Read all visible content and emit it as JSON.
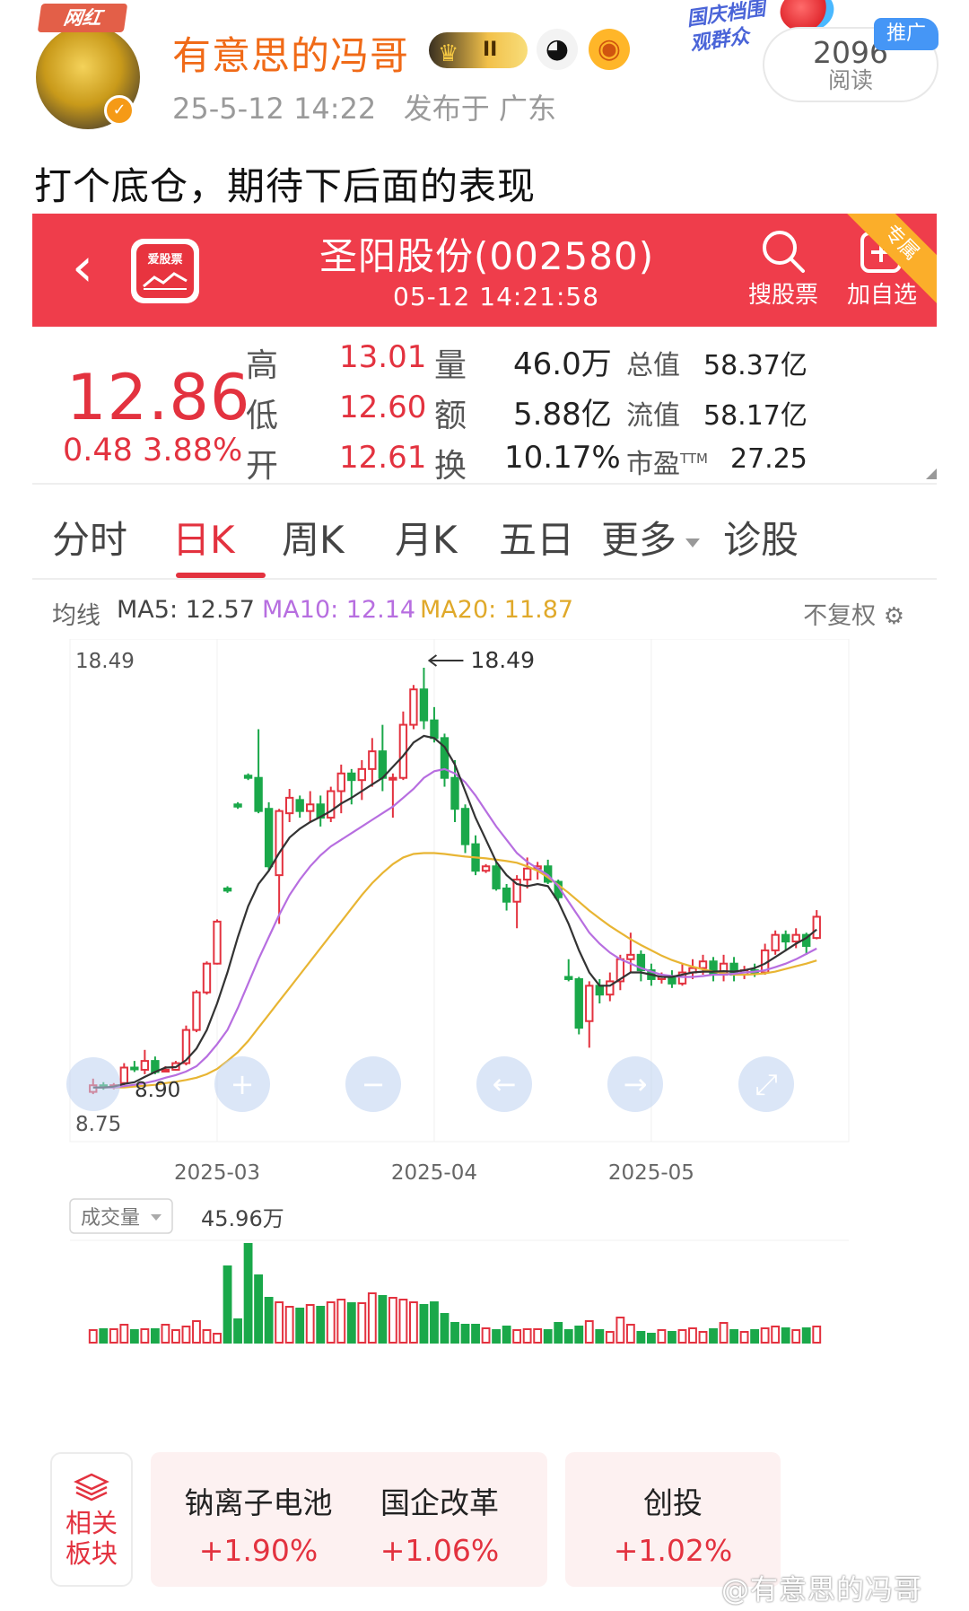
{
  "post": {
    "avatar_badge": "网红",
    "username": "有意思的冯哥",
    "level_badge": "II",
    "posted_time": "25-5-12 14:22",
    "posted_from": "发布于 广东",
    "read_count": "2096",
    "read_label": "阅读",
    "promo_tag": "推广",
    "event_text": "国庆档围观群众",
    "text": "打个底仓，期待下后面的表现"
  },
  "stock": {
    "app_name": "爱股票",
    "title": "圣阳股份(002580)",
    "time": "05-12 14:21:58",
    "search_label": "搜股票",
    "add_label": "加自选",
    "ribbon": "专属",
    "price": "12.86",
    "change": "0.48 3.88%",
    "quote": [
      {
        "label": "高",
        "value": "13.01"
      },
      {
        "label": "低",
        "value": "12.60"
      },
      {
        "label": "开",
        "value": "12.61"
      }
    ],
    "quote2": [
      {
        "label": "量",
        "value": "46.0万"
      },
      {
        "label": "额",
        "value": "5.88亿"
      },
      {
        "label": "换",
        "value": "10.17%"
      }
    ],
    "quote3": [
      {
        "label": "总值",
        "value": "58.37亿"
      },
      {
        "label": "流值",
        "value": "58.17亿"
      },
      {
        "label": "市盈",
        "sup": "TTM",
        "value": "27.25"
      }
    ],
    "tabs": [
      "分时",
      "日K",
      "周K",
      "月K",
      "五日",
      "更多",
      "诊股"
    ],
    "ma": {
      "label": "均线",
      "ma5": "MA5: 12.57",
      "ma10": "MA10: 12.14",
      "ma20": "MA20: 11.87",
      "fq": "不复权"
    },
    "volume_label": "成交量",
    "volume_value": "45.96万",
    "related_label": "相关板块",
    "related": [
      {
        "name": "钠离子电池",
        "pct": "+1.90%"
      },
      {
        "name": "国企改革",
        "pct": "+1.06%"
      },
      {
        "name": "创投",
        "pct": "+1.02%"
      }
    ],
    "watermark": "@有意思的冯哥"
  },
  "colors": {
    "red": "#e3323f",
    "green": "#1aa84a",
    "ma5": "#333333",
    "ma10": "#b76ee0",
    "ma20": "#e8b533",
    "topbar": "#ef3d4b"
  },
  "chart_data": {
    "type": "candlestick",
    "max_label": "18.49",
    "min_label": "8.75",
    "high_annotation": "18.49",
    "low_annotation": "8.90",
    "x_ticks": [
      "2025-03",
      "2025-04",
      "2025-05"
    ],
    "ylim": [
      8.75,
      18.49
    ],
    "candles": [
      [
        8.9,
        9.05,
        8.85,
        9.2
      ],
      [
        9.05,
        9.0,
        8.95,
        9.12
      ],
      [
        9.0,
        9.05,
        8.96,
        9.1
      ],
      [
        9.1,
        9.45,
        9.05,
        9.55
      ],
      [
        9.45,
        9.42,
        9.35,
        9.6
      ],
      [
        9.4,
        9.6,
        9.3,
        9.85
      ],
      [
        9.6,
        9.35,
        9.3,
        9.7
      ],
      [
        9.4,
        9.4,
        9.35,
        9.48
      ],
      [
        9.4,
        9.55,
        9.38,
        9.6
      ],
      [
        9.55,
        10.3,
        9.5,
        10.4
      ],
      [
        10.3,
        11.15,
        10.25,
        11.2
      ],
      [
        11.15,
        11.8,
        11.1,
        11.85
      ],
      [
        11.8,
        12.75,
        11.78,
        12.8
      ],
      [
        13.5,
        13.45,
        13.4,
        13.55
      ],
      [
        15.4,
        15.35,
        15.3,
        15.45
      ],
      [
        16.05,
        16.0,
        15.95,
        16.1
      ],
      [
        16.0,
        15.25,
        15.2,
        17.1
      ],
      [
        15.3,
        14.0,
        13.9,
        15.45
      ],
      [
        13.8,
        15.25,
        12.7,
        15.3
      ],
      [
        15.2,
        15.55,
        15.0,
        15.75
      ],
      [
        15.5,
        15.25,
        15.1,
        15.6
      ],
      [
        15.25,
        15.4,
        15.0,
        15.7
      ],
      [
        15.4,
        15.1,
        14.9,
        15.6
      ],
      [
        15.1,
        15.7,
        15.0,
        15.8
      ],
      [
        15.7,
        16.1,
        15.2,
        16.3
      ],
      [
        16.1,
        15.95,
        15.4,
        16.2
      ],
      [
        15.95,
        16.2,
        15.5,
        16.4
      ],
      [
        16.2,
        16.6,
        15.8,
        16.9
      ],
      [
        16.6,
        16.0,
        15.7,
        17.2
      ],
      [
        16.0,
        16.0,
        15.1,
        16.1
      ],
      [
        16.0,
        17.2,
        15.95,
        17.5
      ],
      [
        17.2,
        18.0,
        17.1,
        18.1
      ],
      [
        18.0,
        17.3,
        17.1,
        18.49
      ],
      [
        17.3,
        16.9,
        16.8,
        17.6
      ],
      [
        16.9,
        16.0,
        15.8,
        17.0
      ],
      [
        16.0,
        15.3,
        15.0,
        16.4
      ],
      [
        15.3,
        14.5,
        14.3,
        15.4
      ],
      [
        14.5,
        13.9,
        13.8,
        14.7
      ],
      [
        13.9,
        14.0,
        13.85,
        14.05
      ],
      [
        14.0,
        13.5,
        13.45,
        14.1
      ],
      [
        13.5,
        13.2,
        13.0,
        13.6
      ],
      [
        13.2,
        13.7,
        12.6,
        13.8
      ],
      [
        13.7,
        13.95,
        13.5,
        14.2
      ],
      [
        13.95,
        14.0,
        13.7,
        14.1
      ],
      [
        14.0,
        13.65,
        13.6,
        14.15
      ],
      [
        13.65,
        13.3,
        13.2,
        13.7
      ],
      [
        11.5,
        11.45,
        11.4,
        11.9
      ],
      [
        11.45,
        10.35,
        10.2,
        11.5
      ],
      [
        10.5,
        11.3,
        9.9,
        11.4
      ],
      [
        11.3,
        11.1,
        10.9,
        11.45
      ],
      [
        11.1,
        11.4,
        10.95,
        11.6
      ],
      [
        11.4,
        11.9,
        11.2,
        12.0
      ],
      [
        11.9,
        12.0,
        11.6,
        12.5
      ],
      [
        12.0,
        11.65,
        11.4,
        12.1
      ],
      [
        11.65,
        11.45,
        11.3,
        11.8
      ],
      [
        11.45,
        11.5,
        11.35,
        11.6
      ],
      [
        11.5,
        11.35,
        11.25,
        11.65
      ],
      [
        11.35,
        11.6,
        11.3,
        11.8
      ],
      [
        11.6,
        11.7,
        11.45,
        11.9
      ],
      [
        11.7,
        11.85,
        11.55,
        12.0
      ],
      [
        11.85,
        11.55,
        11.4,
        11.95
      ],
      [
        11.55,
        11.8,
        11.4,
        12.0
      ],
      [
        11.8,
        11.55,
        11.4,
        11.95
      ],
      [
        11.55,
        11.65,
        11.45,
        11.75
      ],
      [
        11.65,
        11.6,
        11.5,
        11.8
      ],
      [
        11.6,
        12.1,
        11.55,
        12.25
      ],
      [
        12.1,
        12.45,
        12.0,
        12.55
      ],
      [
        12.45,
        12.3,
        12.1,
        12.55
      ],
      [
        12.3,
        12.45,
        12.15,
        12.6
      ],
      [
        12.45,
        12.2,
        12.0,
        12.5
      ],
      [
        12.38,
        12.86,
        12.35,
        13.01
      ]
    ],
    "ma5": [
      9.0,
      9.0,
      9.02,
      9.08,
      9.12,
      9.24,
      9.35,
      9.45,
      9.46,
      9.62,
      9.88,
      10.3,
      10.9,
      11.6,
      12.4,
      13.1,
      13.6,
      13.9,
      14.3,
      14.65,
      14.85,
      15.0,
      15.12,
      15.25,
      15.42,
      15.55,
      15.7,
      15.85,
      16.0,
      16.25,
      16.5,
      16.8,
      16.95,
      16.9,
      16.7,
      16.3,
      15.7,
      15.1,
      14.6,
      14.1,
      13.8,
      13.6,
      13.55,
      13.6,
      13.55,
      13.2,
      12.7,
      12.1,
      11.6,
      11.3,
      11.3,
      11.45,
      11.6,
      11.6,
      11.55,
      11.5,
      11.5,
      11.55,
      11.6,
      11.62,
      11.62,
      11.63,
      11.62,
      11.65,
      11.7,
      11.8,
      11.95,
      12.1,
      12.25,
      12.38,
      12.57
    ],
    "ma10": [
      9.0,
      9.0,
      9.0,
      9.03,
      9.06,
      9.1,
      9.15,
      9.22,
      9.28,
      9.36,
      9.48,
      9.7,
      9.98,
      10.3,
      10.8,
      11.35,
      11.9,
      12.4,
      12.9,
      13.35,
      13.7,
      14.0,
      14.25,
      14.45,
      14.6,
      14.75,
      14.9,
      15.05,
      15.2,
      15.35,
      15.55,
      15.75,
      16.0,
      16.15,
      16.2,
      16.1,
      15.9,
      15.6,
      15.25,
      14.9,
      14.6,
      14.3,
      14.1,
      13.95,
      13.8,
      13.55,
      13.2,
      12.85,
      12.5,
      12.25,
      12.05,
      11.9,
      11.8,
      11.7,
      11.62,
      11.55,
      11.52,
      11.5,
      11.5,
      11.52,
      11.55,
      11.55,
      11.57,
      11.6,
      11.62,
      11.65,
      11.72,
      11.8,
      11.9,
      12.02,
      12.14
    ],
    "ma20": [
      9.0,
      9.0,
      9.0,
      9.0,
      9.02,
      9.04,
      9.06,
      9.1,
      9.13,
      9.17,
      9.22,
      9.3,
      9.42,
      9.6,
      9.8,
      10.05,
      10.35,
      10.65,
      10.95,
      11.25,
      11.55,
      11.85,
      12.15,
      12.45,
      12.75,
      13.05,
      13.35,
      13.62,
      13.85,
      14.05,
      14.2,
      14.28,
      14.3,
      14.3,
      14.28,
      14.25,
      14.22,
      14.2,
      14.18,
      14.15,
      14.12,
      14.08,
      14.0,
      13.9,
      13.75,
      13.58,
      13.4,
      13.2,
      13.0,
      12.82,
      12.65,
      12.5,
      12.35,
      12.22,
      12.1,
      11.98,
      11.88,
      11.8,
      11.73,
      11.67,
      11.62,
      11.58,
      11.55,
      11.55,
      11.56,
      11.58,
      11.62,
      11.68,
      11.74,
      11.8,
      11.87
    ],
    "volume": [
      14,
      15,
      15,
      20,
      14,
      15,
      15,
      20,
      14,
      18,
      24,
      14,
      10,
      85,
      26,
      110,
      75,
      50,
      45,
      40,
      38,
      42,
      40,
      45,
      48,
      44,
      44,
      55,
      52,
      50,
      48,
      45,
      42,
      45,
      32,
      22,
      20,
      20,
      16,
      14,
      18,
      14,
      15,
      15,
      14,
      22,
      14,
      18,
      24,
      14,
      12,
      28,
      20,
      12,
      10,
      14,
      12,
      14,
      16,
      12,
      15,
      22,
      14,
      12,
      14,
      16,
      18,
      16,
      14,
      16,
      18
    ]
  }
}
